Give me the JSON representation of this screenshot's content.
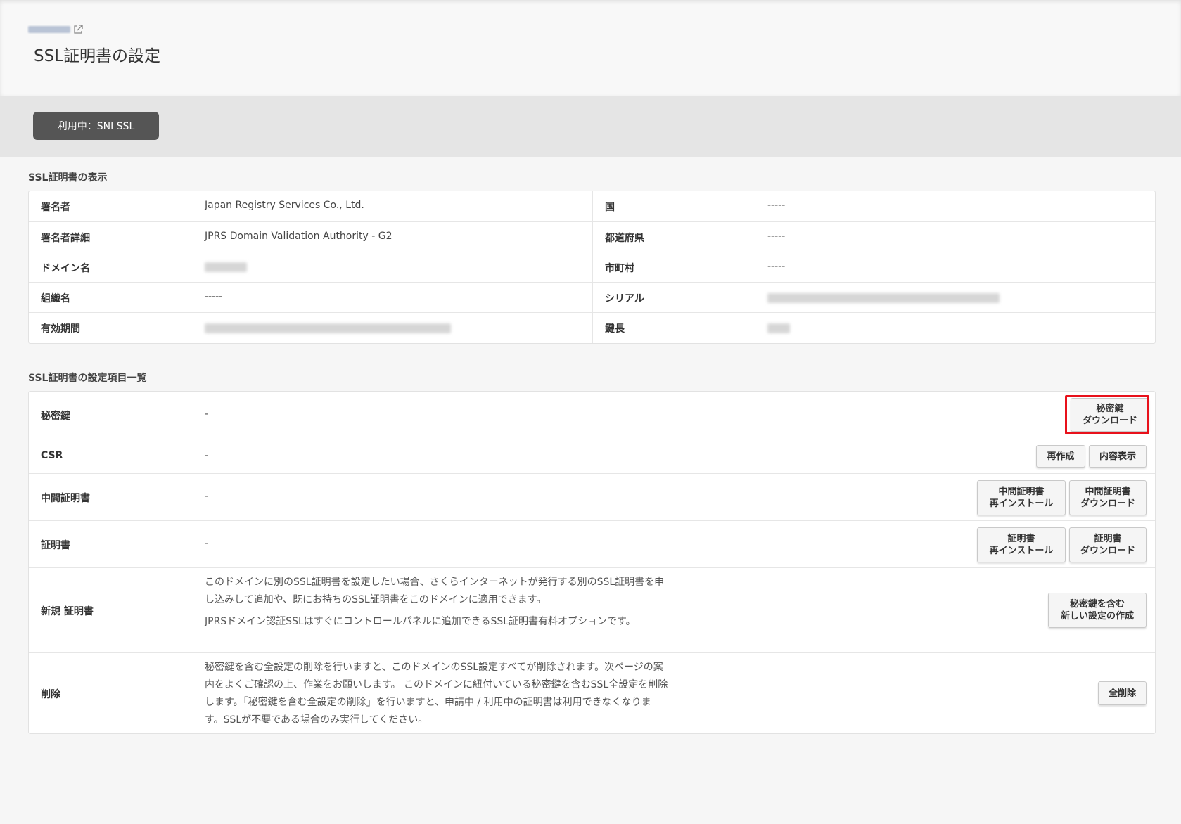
{
  "header": {
    "breadcrumb_text": "",
    "page_title": "SSL証明書の設定"
  },
  "status": {
    "label": "利用中：SNI SSL"
  },
  "cert_display": {
    "section_title": "SSL証明書の表示",
    "left": [
      {
        "label": "署名者",
        "value": "Japan Registry Services Co., Ltd."
      },
      {
        "label": "署名者詳細",
        "value": "JPRS Domain Validation Authority - G2"
      },
      {
        "label": "ドメイン名",
        "value": ""
      },
      {
        "label": "組織名",
        "value": "-----"
      },
      {
        "label": "有効期間",
        "value": ""
      }
    ],
    "right": [
      {
        "label": "国",
        "value": "-----"
      },
      {
        "label": "都道府県",
        "value": "-----"
      },
      {
        "label": "市町村",
        "value": "-----"
      },
      {
        "label": "シリアル",
        "value": ""
      },
      {
        "label": "鍵長",
        "value": ""
      }
    ]
  },
  "settings": {
    "section_title": "SSL証明書の設定項目一覧",
    "rows": {
      "private_key": {
        "label": "秘密鍵",
        "value": "-",
        "download_label": "秘密鍵\nダウンロード"
      },
      "csr": {
        "label": "CSR",
        "value": "-",
        "recreate_label": "再作成",
        "view_label": "内容表示"
      },
      "intermediate": {
        "label": "中間証明書",
        "value": "-",
        "reinstall_label": "中間証明書\n再インストール",
        "download_label": "中間証明書\nダウンロード"
      },
      "certificate": {
        "label": "証明書",
        "value": "-",
        "reinstall_label": "証明書\n再インストール",
        "download_label": "証明書\nダウンロード"
      },
      "new_cert": {
        "label": "新規 証明書",
        "desc1": "このドメインに別のSSL証明書を設定したい場合、さくらインターネットが発行する別のSSL証明書を申し込みして追加や、既にお持ちのSSL証明書をこのドメインに適用できます。",
        "desc2": "JPRSドメイン認証SSLはすぐにコントロールパネルに追加できるSSL証明書有料オプションです。",
        "button_label": "秘密鍵を含む\n新しい設定の作成"
      },
      "delete": {
        "label": "削除",
        "desc": "秘密鍵を含む全設定の削除を行いますと、このドメインのSSL設定すべてが削除されます。次ページの案内をよくご確認の上、作業をお願いします。 このドメインに紐付いている秘密鍵を含むSSL全設定を削除します。「秘密鍵を含む全設定の削除」を行いますと、申請中 / 利用中の証明書は利用できなくなります。SSLが不要である場合のみ実行してください。",
        "button_label": "全削除"
      }
    }
  },
  "colors": {
    "highlight": "#e8111b",
    "status_pill": "#555555"
  },
  "icons": {
    "breadcrumb_link": "external-link-icon"
  }
}
